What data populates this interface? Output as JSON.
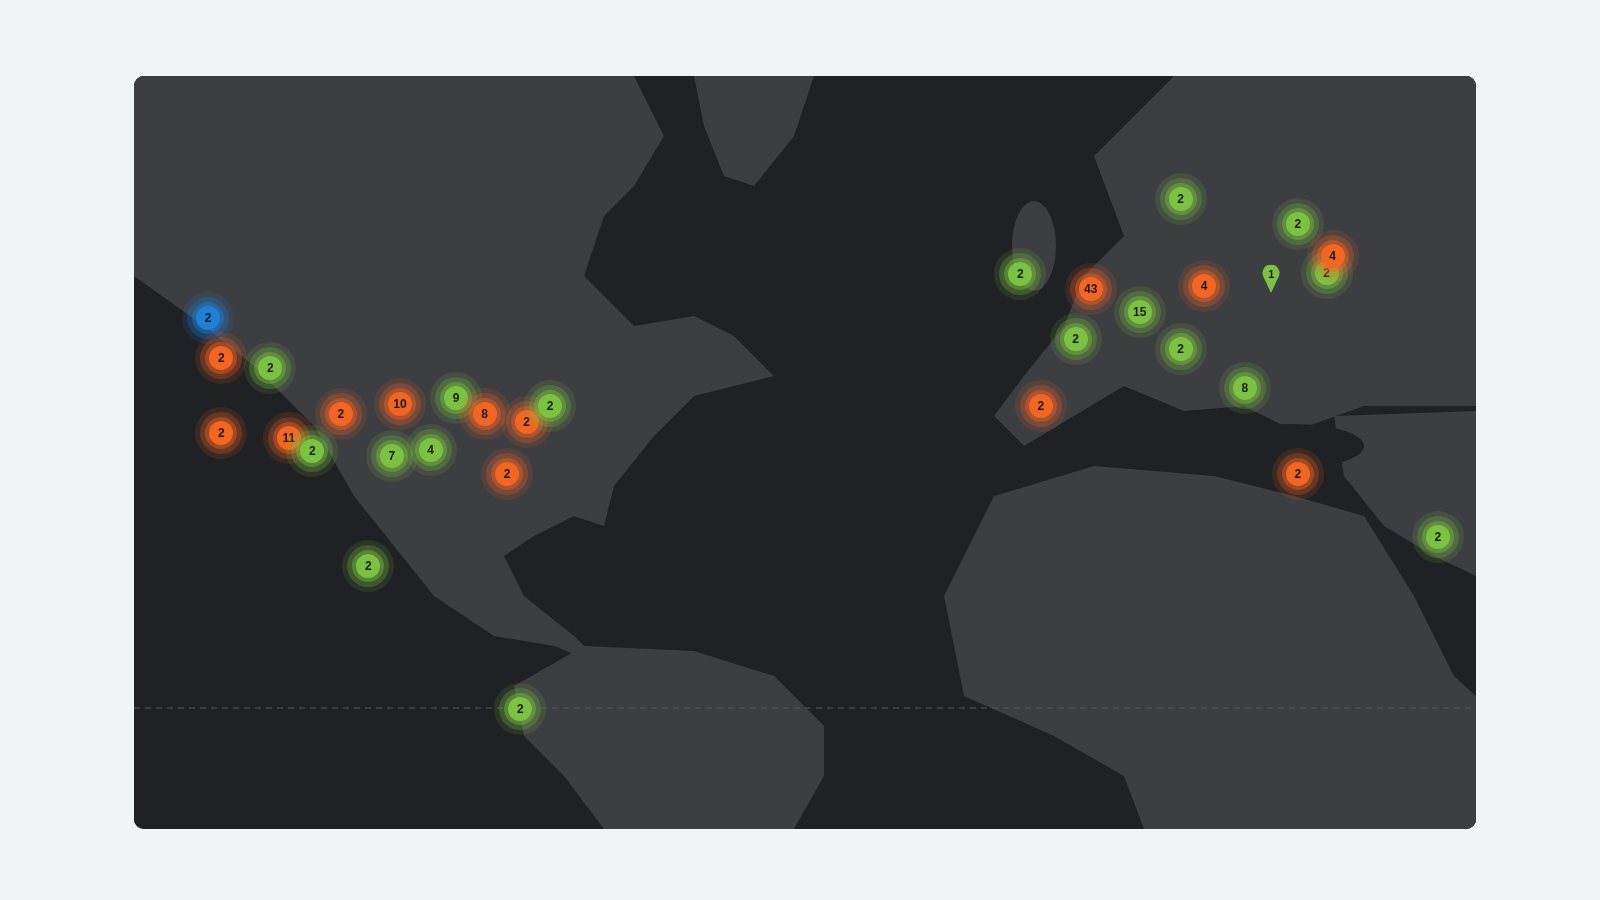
{
  "map": {
    "kind": "picture",
    "markers": [
      {
        "kind": "cluster",
        "count": "2",
        "color": "#1f7fd6"
      },
      {
        "kind": "cluster",
        "count": "2",
        "color": "#f26522"
      },
      {
        "kind": "cluster",
        "count": "2",
        "color": "#7cc242"
      },
      {
        "kind": "cluster",
        "count": "2",
        "color": "#f26522"
      },
      {
        "kind": "cluster",
        "count": "11",
        "color": "#f26522"
      },
      {
        "kind": "cluster",
        "count": "2",
        "color": "#7cc242"
      },
      {
        "kind": "cluster",
        "count": "2",
        "color": "#f26522"
      },
      {
        "kind": "cluster",
        "count": "10",
        "color": "#f26522"
      },
      {
        "kind": "cluster",
        "count": "9",
        "color": "#7cc242"
      },
      {
        "kind": "cluster",
        "count": "7",
        "color": "#7cc242"
      },
      {
        "kind": "cluster",
        "count": "4",
        "color": "#7cc242"
      },
      {
        "kind": "cluster",
        "count": "8",
        "color": "#f26522"
      },
      {
        "kind": "cluster",
        "count": "2",
        "color": "#f26522"
      },
      {
        "kind": "cluster",
        "count": "2",
        "color": "#7cc242"
      },
      {
        "kind": "cluster",
        "count": "2",
        "color": "#f26522"
      },
      {
        "kind": "cluster",
        "count": "2",
        "color": "#7cc242"
      },
      {
        "kind": "cluster",
        "count": "2",
        "color": "#7cc242"
      },
      {
        "kind": "cluster",
        "count": "2",
        "color": "#7cc242"
      },
      {
        "kind": "cluster",
        "count": "43",
        "color": "#f26522"
      },
      {
        "kind": "cluster",
        "count": "15",
        "color": "#7cc242"
      },
      {
        "kind": "cluster",
        "count": "2",
        "color": "#7cc242"
      },
      {
        "kind": "cluster",
        "count": "2",
        "color": "#7cc242"
      },
      {
        "kind": "cluster",
        "count": "2",
        "color": "#7cc242"
      },
      {
        "kind": "cluster",
        "count": "4",
        "color": "#f26522"
      },
      {
        "kind": "pin",
        "count": "1",
        "color": "#7cc242"
      },
      {
        "kind": "cluster",
        "count": "2",
        "color": "#7cc242"
      },
      {
        "kind": "cluster",
        "count": "2",
        "color": "#7cc242"
      },
      {
        "kind": "cluster",
        "count": "4",
        "color": "#f26522"
      },
      {
        "kind": "cluster",
        "count": "8",
        "color": "#7cc242"
      },
      {
        "kind": "cluster",
        "count": "2",
        "color": "#f26522"
      },
      {
        "kind": "cluster",
        "count": "2",
        "color": "#f26522"
      },
      {
        "kind": "cluster",
        "count": "2",
        "color": "#7cc242"
      }
    ]
  }
}
